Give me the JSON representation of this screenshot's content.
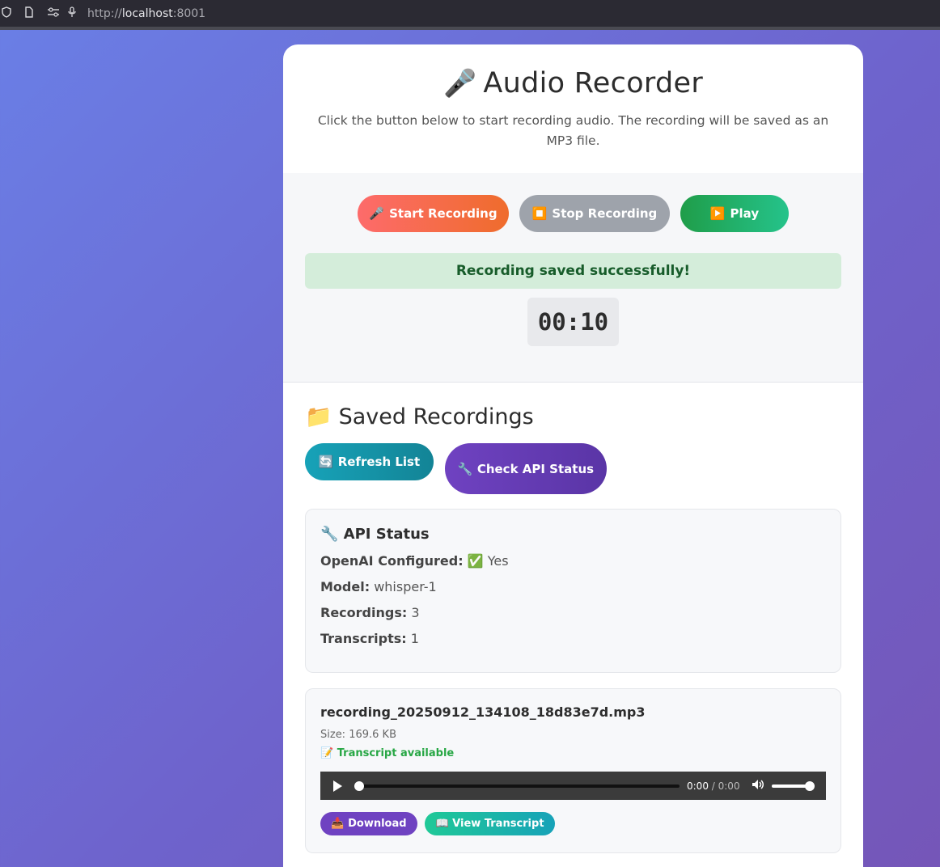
{
  "browser": {
    "url_prefix": "http://",
    "url_host": "localhost",
    "url_port": ":8001"
  },
  "header": {
    "mic_emoji": "🎤",
    "title": "Audio Recorder",
    "subtitle": "Click the button below to start recording audio. The recording will be saved as an MP3 file."
  },
  "controls": {
    "start": {
      "icon": "🎤",
      "label": "Start Recording"
    },
    "stop": {
      "icon": "⏹️",
      "label": "Stop Recording"
    },
    "play": {
      "icon": "▶️",
      "label": "Play"
    },
    "status_message": "Recording saved successfully!",
    "timer": "00:10"
  },
  "recordings": {
    "folder_emoji": "📁",
    "title": "Saved Recordings",
    "refresh_label": "🔄 Refresh List",
    "api_check_label": "🔧 Check API Status"
  },
  "api_status": {
    "title": "🔧 API Status",
    "rows": [
      {
        "label": "OpenAI Configured:",
        "value": "✅ Yes"
      },
      {
        "label": "Model:",
        "value": "whisper-1"
      },
      {
        "label": "Recordings:",
        "value": "3"
      },
      {
        "label": "Transcripts:",
        "value": "1"
      }
    ]
  },
  "recording_items": [
    {
      "file_name": "recording_20250912_134108_18d83e7d.mp3",
      "size": "Size: 169.6 KB",
      "transcript_note": "📝 Transcript available",
      "player": {
        "current": "0:00",
        "separator": " / ",
        "duration": "0:00",
        "progress": 0,
        "volume": 1
      },
      "download_label": "📥 Download",
      "transcript_label": "📖 View Transcript"
    }
  ],
  "colors": {
    "accent_purple": "#6f42c1",
    "success_green": "#28a745",
    "info_teal": "#17a2b8"
  }
}
